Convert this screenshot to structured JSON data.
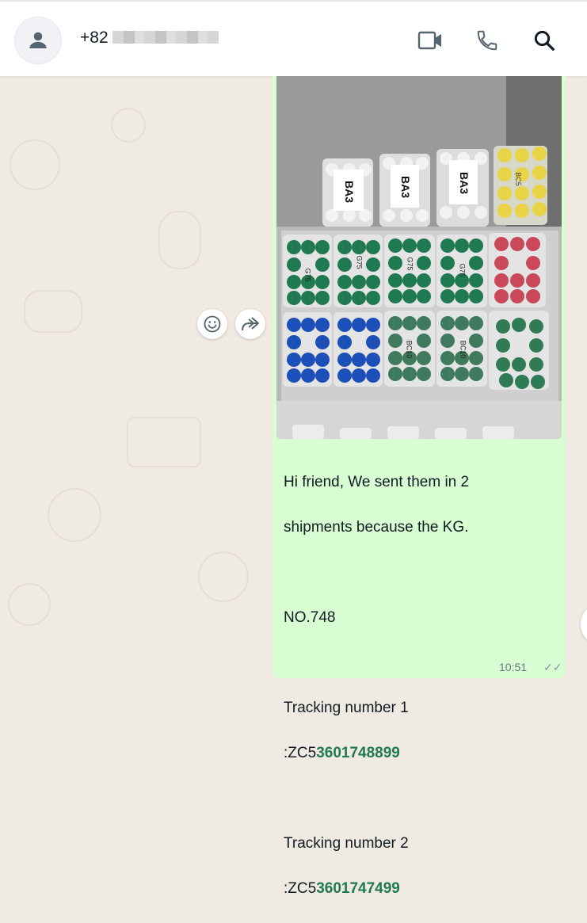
{
  "header": {
    "contact_name": "+82",
    "icons": [
      "person-icon",
      "video-call-icon",
      "voice-call-icon",
      "search-icon"
    ]
  },
  "message": {
    "photo_labels": [
      "BA3",
      "BA3",
      "BA3",
      "BC5",
      "G75",
      "G75",
      "G75",
      "G75",
      "BC10",
      "BC10"
    ],
    "lines": [
      "Hi friend,  We sent them in 2",
      "shipments because the KG.",
      "",
      "NO.748",
      "",
      "Tracking number 1"
    ],
    "tracking1_prefix": ":ZC5",
    "tracking1_link": "3601748899",
    "tracking2_label": "Tracking number 2",
    "tracking2_prefix": ":ZC5",
    "tracking2_link": "3601747499",
    "time": "10:51"
  },
  "actions": {
    "react_icon": "emoji-icon",
    "forward_icon": "forward-icon"
  },
  "colors": {
    "chat_background": "#efeae2",
    "bubble_outgoing": "#d9fdd3",
    "link": "#1f7a52",
    "header_icon": "#54656f"
  }
}
